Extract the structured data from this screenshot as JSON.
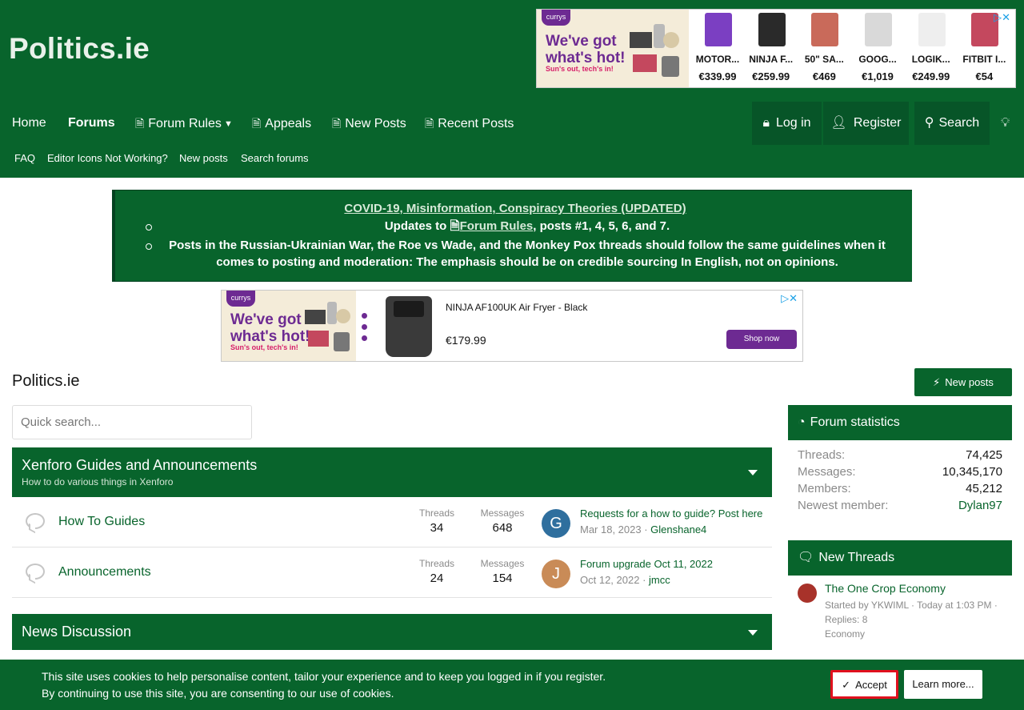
{
  "site": {
    "title": "Politics.ie"
  },
  "top_ad": {
    "badge": "currys",
    "headline": "We've got what's hot!",
    "tagline": "Sun's out, tech's in!",
    "products": [
      {
        "name": "MOTOR...",
        "price": "€339.99",
        "color": "#7b3fc2"
      },
      {
        "name": "NINJA F...",
        "price": "€259.99",
        "color": "#2a2a2a"
      },
      {
        "name": "50\" SA...",
        "price": "€469",
        "color": "#c96a5a"
      },
      {
        "name": "GOOG...",
        "price": "€1,019",
        "color": "#d9d9d9"
      },
      {
        "name": "LOGIK...",
        "price": "€249.99",
        "color": "#eeeeee"
      },
      {
        "name": "FITBIT I...",
        "price": "€54",
        "color": "#c4485e"
      }
    ]
  },
  "nav": {
    "home": "Home",
    "forums": "Forums",
    "forum_rules": "Forum Rules",
    "appeals": "Appeals",
    "new_posts": "New Posts",
    "recent_posts": "Recent Posts",
    "login": "Log in",
    "register": "Register",
    "search": "Search"
  },
  "subnav": [
    "FAQ",
    "Editor Icons Not Working?",
    "New posts",
    "Search forums"
  ],
  "notice": {
    "link": "COVID-19, Misinformation, Conspiracy Theories (UPDATED)",
    "item1_prefix": "Updates to",
    "item1_link": "Forum Rules",
    "item1_suffix": ", posts #1, 4, 5, 6, and 7.",
    "item2": "Posts in the Russian-Ukrainian War, the Roe vs Wade, and the Monkey Pox threads should follow the same guidelines when it comes to posting and moderation: The emphasis should be on credible sourcing In English, not on opinions."
  },
  "mid_ad": {
    "badge": "currys",
    "headline": "We've got what's hot!",
    "tagline": "Sun's out, tech's in!",
    "product": "NINJA AF100UK Air Fryer - Black",
    "price": "€179.99",
    "cta": "Shop now"
  },
  "page": {
    "title": "Politics.ie",
    "new_posts_button": "New posts",
    "search_placeholder": "Quick search..."
  },
  "categories": [
    {
      "title": "Xenforo Guides and Announcements",
      "description": "How to do various things in Xenforo",
      "forums": [
        {
          "name": "How To Guides",
          "threads_label": "Threads",
          "threads": "34",
          "messages_label": "Messages",
          "messages": "648",
          "avatar": "G",
          "avatar_color": "#2f6f9e",
          "last_title": "Requests for a how to guide? Post here",
          "last_date": "Mar 18, 2023",
          "last_user": "Glenshane4"
        },
        {
          "name": "Announcements",
          "threads_label": "Threads",
          "threads": "24",
          "messages_label": "Messages",
          "messages": "154",
          "avatar": "J",
          "avatar_color": "#c98b57",
          "last_title": "Forum upgrade Oct 11, 2022",
          "last_date": "Oct 12, 2022",
          "last_user": "jmcc"
        }
      ]
    },
    {
      "title": "News Discussion"
    }
  ],
  "sidebar": {
    "stats_title": "Forum statistics",
    "stats": [
      {
        "label": "Threads:",
        "value": "74,425"
      },
      {
        "label": "Messages:",
        "value": "10,345,170"
      },
      {
        "label": "Members:",
        "value": "45,212"
      },
      {
        "label": "Newest member:",
        "value": "Dylan97"
      }
    ],
    "threads_title": "New Threads",
    "threads": [
      {
        "title": "The One Crop Economy",
        "meta": "Started by YKWIML · Today at 1:03 PM · Replies: 8",
        "forum": "Economy"
      }
    ]
  },
  "cookie": {
    "line1": "This site uses cookies to help personalise content, tailor your experience and to keep you logged in if you register.",
    "line2": "By continuing to use this site, you are consenting to our use of cookies.",
    "accept": "Accept",
    "learn_more": "Learn more..."
  },
  "colors": {
    "brand": "#08642c",
    "brand_dark": "#034220",
    "accept_border": "#e0101e"
  }
}
